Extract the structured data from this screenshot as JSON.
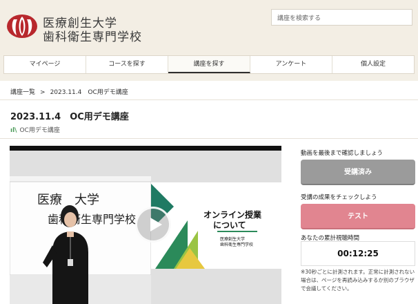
{
  "header": {
    "school_line1": "医療創生大学",
    "school_line2": "歯科衛生専門学校",
    "search_placeholder": "講座を検索する"
  },
  "nav": {
    "items": [
      {
        "label": "マイページ"
      },
      {
        "label": "コースを探す"
      },
      {
        "label": "講座を探す",
        "active": true
      },
      {
        "label": "アンケート"
      },
      {
        "label": "個人設定"
      }
    ]
  },
  "breadcrumb": {
    "root": "講座一覧",
    "sep": ">",
    "current": "2023.11.4　OC用デモ講座"
  },
  "page": {
    "title": "2023.11.4　OC用デモ講座",
    "subtitle": "OC用デモ講座"
  },
  "video": {
    "slide_title_line1": "オンライン授業",
    "slide_title_line2": "について",
    "slide_school1": "医療創生大学",
    "slide_school2": "歯科衛生専門学校",
    "whiteboard_text1": "医療　大学",
    "whiteboard_text2": "歯科衛生専門学校"
  },
  "sidebar": {
    "watch_prompt": "動画を最後まで確認しましょう",
    "done_button": "受講済み",
    "check_prompt": "受講の成果をチェックしよう",
    "test_button": "テスト",
    "time_label": "あなたの累計視聴時間",
    "time_value": "00:12:25",
    "note": "※30秒ごとに計測されます。正常に計測されない場合は、ページを再読み込みするか別のブラウザで会議してください。"
  },
  "colors": {
    "accent_red": "#b8282d",
    "green": "#2b8a5a",
    "test_pink": "#e18590",
    "done_gray": "#9b9b9b"
  }
}
